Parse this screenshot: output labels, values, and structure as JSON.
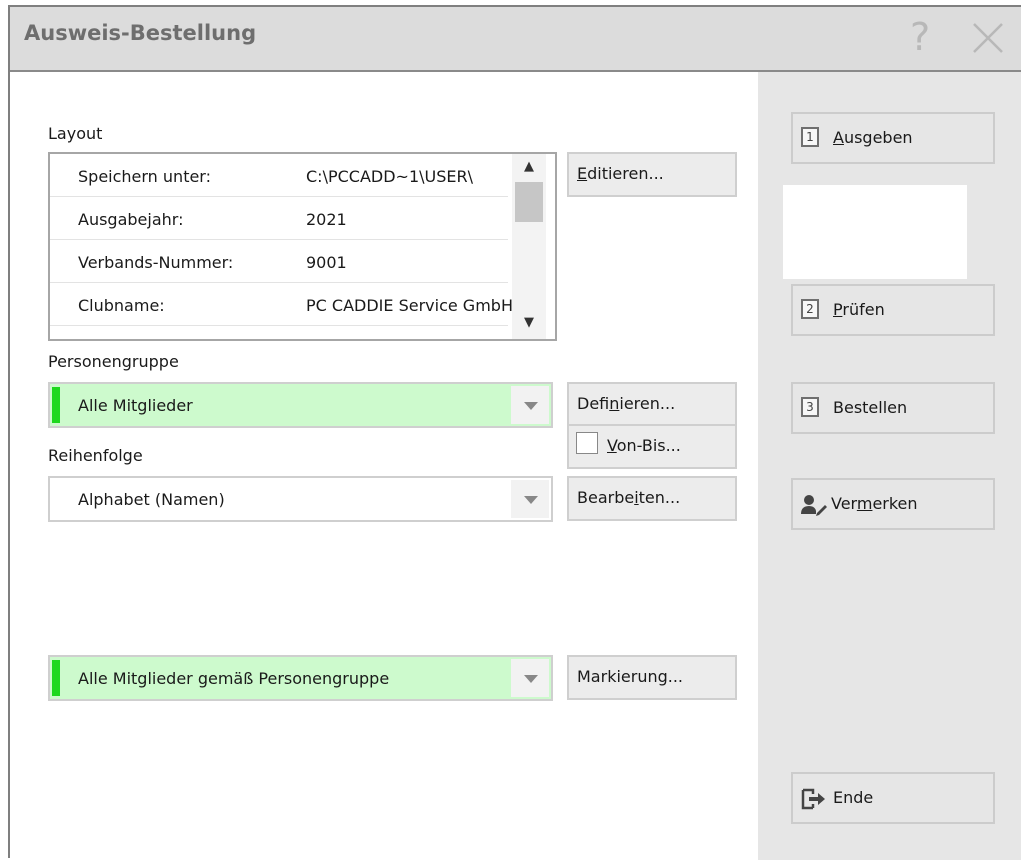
{
  "window": {
    "title": "Ausweis-Bestellung",
    "help_icon": "?",
    "close_icon": "close-icon"
  },
  "layout": {
    "label": "Layout",
    "rows": [
      {
        "key": "Speichern unter:",
        "value": "C:\\PCCADD~1\\USER\\"
      },
      {
        "key": "Ausgabejahr:",
        "value": "2021"
      },
      {
        "key": "Verbands-Nummer:",
        "value": "9001"
      },
      {
        "key": "Clubname:",
        "value": "PC CADDIE Service GmbH"
      }
    ],
    "edit_button": {
      "u": "E",
      "rest": "ditieren..."
    }
  },
  "personengruppe": {
    "label": "Personengruppe",
    "value": "Alle Mitglieder",
    "define_button": {
      "pre": "Defi",
      "u": "n",
      "rest": "ieren..."
    },
    "vonbis": {
      "u": "V",
      "rest": "on-Bis..."
    }
  },
  "reihenfolge": {
    "label": "Reihenfolge",
    "value": "Alphabet (Namen)",
    "edit_button": {
      "pre": "Bearbe",
      "u": "i",
      "rest": "ten..."
    }
  },
  "markierung": {
    "value": "Alle Mitglieder gemäß Personengruppe",
    "button": "Markierung..."
  },
  "sidebar": {
    "ausgeben": {
      "num": "1",
      "u": "A",
      "rest": "usgeben"
    },
    "pruefen": {
      "num": "2",
      "u": "P",
      "rest": "rüfen"
    },
    "bestellen": {
      "num": "3",
      "label": "Bestellen"
    },
    "vermerken": {
      "pre": "Ver",
      "u": "m",
      "rest": "erken",
      "icon": "user-edit-icon"
    },
    "ende": {
      "label": "Ende",
      "icon": "exit-icon"
    }
  },
  "colors": {
    "accent_green": "#1ed81e",
    "green_bg": "#cdfacd",
    "sidebar_bg": "#e6e6e6",
    "titlebar_bg": "#dcdcdc"
  }
}
